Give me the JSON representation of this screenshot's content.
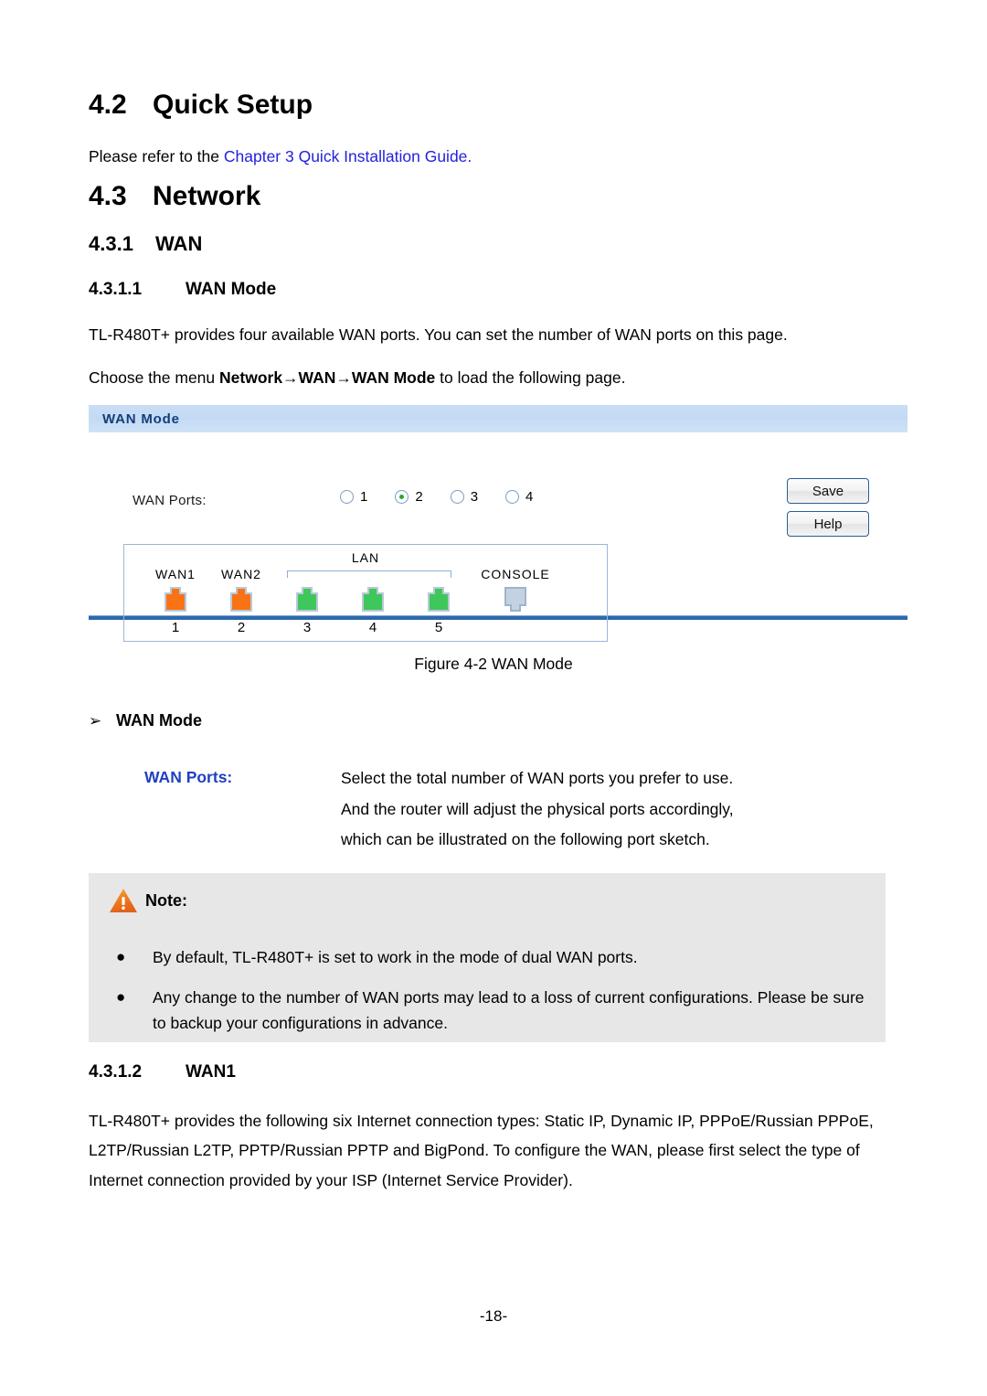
{
  "document": {
    "section_quick_setup": {
      "number": "4.2",
      "title": "Quick Setup",
      "paragraph_prefix": "Please refer to the ",
      "paragraph_link": "Chapter 3 Quick Installation Guide",
      "paragraph_suffix": "."
    },
    "section_network": {
      "number": "4.3",
      "title": "Network"
    },
    "section_wan": {
      "number": "4.3.1",
      "title": "WAN"
    },
    "section_wan_mode": {
      "number": "4.3.1.1",
      "title": "WAN Mode",
      "paragraph1": "TL-R480T+ provides four available WAN ports. You can set the number of WAN ports on this page.",
      "paragraph2_prefix": "Choose the menu ",
      "paragraph2_menu": "Network→WAN→WAN Mode",
      "paragraph2_suffix": " to load the following page."
    },
    "figure": {
      "caption": "Figure 4-2 WAN Mode"
    },
    "definition": {
      "heading_arrow": "➢",
      "heading": "WAN Mode",
      "term": "WAN Ports:",
      "description_lines": [
        "Select the total number of WAN ports you prefer to use.",
        "And the router will adjust the physical ports accordingly,",
        "which can be illustrated on the following port sketch."
      ]
    },
    "note": {
      "label": "Note:",
      "bullet_glyph": "●",
      "items": [
        "By default, TL-R480T+ is set to work in the mode of dual WAN ports.",
        "Any change to the number of WAN ports may lead to a loss of current configurations. Please be sure to backup your configurations in advance."
      ]
    },
    "section_wan1": {
      "number": "4.3.1.2",
      "title": "WAN1",
      "paragraph": "TL-R480T+ provides the following six Internet connection types: Static IP, Dynamic IP, PPPoE/Russian PPPoE, L2TP/Russian L2TP, PPTP/Russian PPTP and BigPond. To configure the WAN, please first select the type of Internet connection provided by your ISP (Internet Service Provider)."
    },
    "footer": {
      "page_number": "-18-"
    }
  },
  "ui_panel": {
    "header_title": "WAN Mode",
    "wan_ports_label": "WAN Ports:",
    "radio_options": [
      {
        "value": "1",
        "selected": false
      },
      {
        "value": "2",
        "selected": true
      },
      {
        "value": "3",
        "selected": false
      },
      {
        "value": "4",
        "selected": false
      }
    ],
    "buttons": {
      "save": "Save",
      "help": "Help"
    },
    "port_sketch": {
      "lan_label": "LAN",
      "ports": [
        {
          "name": "WAN1",
          "number": "1",
          "color": "#f97316",
          "type": "rj45"
        },
        {
          "name": "WAN2",
          "number": "2",
          "color": "#f97316",
          "type": "rj45"
        },
        {
          "name": "",
          "number": "3",
          "color": "#3ec75a",
          "type": "rj45"
        },
        {
          "name": "",
          "number": "4",
          "color": "#3ec75a",
          "type": "rj45"
        },
        {
          "name": "",
          "number": "5",
          "color": "#3ec75a",
          "type": "rj45"
        },
        {
          "name": "CONSOLE",
          "number": "",
          "color": "#c3d2e2",
          "type": "console"
        }
      ]
    },
    "colors": {
      "header_bg": "#c4daf4",
      "header_text": "#123f7a",
      "rule": "#2d68ab",
      "wan_port": "#f97316",
      "lan_port": "#3ec75a",
      "console_port": "#c3d2e2",
      "radio_selected": "#2aa82a",
      "link": "#2222dd",
      "term": "#2040c0",
      "note_bg": "#e7e7e7",
      "warning": "#ef7b24"
    }
  }
}
